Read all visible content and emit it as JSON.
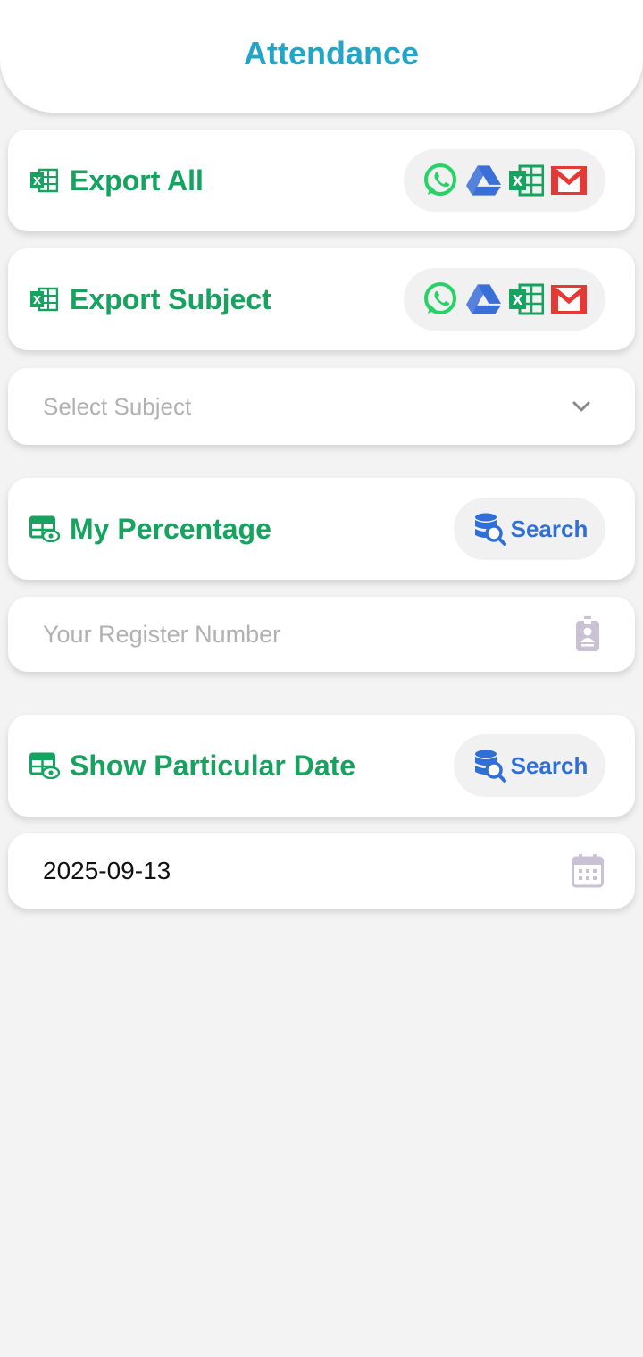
{
  "header": {
    "title": "Attendance"
  },
  "export_all": {
    "label": "Export All",
    "share_icons": [
      "whatsapp-icon",
      "google-drive-icon",
      "excel-icon",
      "gmail-icon"
    ]
  },
  "export_subject": {
    "label": "Export Subject",
    "share_icons": [
      "whatsapp-icon",
      "google-drive-icon",
      "excel-icon",
      "gmail-icon"
    ]
  },
  "subject_select": {
    "placeholder": "Select Subject"
  },
  "my_percentage": {
    "label": "My Percentage",
    "search_label": "Search"
  },
  "register_input": {
    "placeholder": "Your Register Number",
    "value": ""
  },
  "particular_date": {
    "label": "Show Particular Date",
    "search_label": "Search"
  },
  "date_input": {
    "value": "2025-09-13"
  },
  "colors": {
    "title": "#22a6c8",
    "accent_green": "#16a35f",
    "search_blue": "#2f6fd6",
    "whatsapp": "#25d366",
    "gmail_red": "#e53935",
    "drive_blue": "#3a6fd8",
    "placeholder_grey": "#b1b1b1",
    "background": "#f3f3f3"
  }
}
